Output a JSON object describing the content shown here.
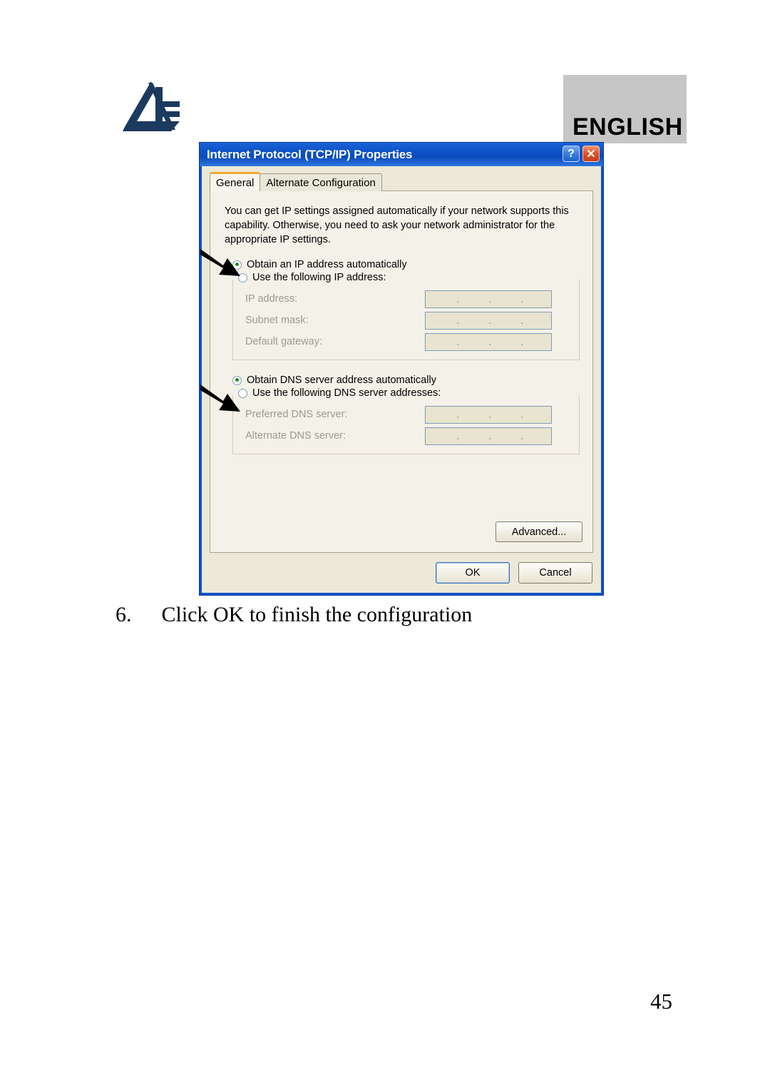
{
  "page": {
    "language_badge": "ENGLISH",
    "page_number": "45",
    "logo_name": "atlantis-land-logo"
  },
  "dialog": {
    "title": "Internet Protocol (TCP/IP) Properties",
    "titlebar_buttons": [
      {
        "name": "help-button",
        "glyph": "?"
      },
      {
        "name": "close-button",
        "glyph": "✕"
      }
    ],
    "tabs": [
      {
        "label": "General",
        "active": true
      },
      {
        "label": "Alternate Configuration",
        "active": false
      }
    ],
    "intro_text": "You can get IP settings assigned automatically if your network supports this capability. Otherwise, you need to ask your network administrator for the appropriate IP settings.",
    "ip_section": {
      "auto_radio_label": "Obtain an IP address automatically",
      "auto_radio_checked": true,
      "manual_radio_label": "Use the following IP address:",
      "manual_radio_checked": false,
      "fields": [
        {
          "label": "IP address:",
          "value": ""
        },
        {
          "label": "Subnet mask:",
          "value": ""
        },
        {
          "label": "Default gateway:",
          "value": ""
        }
      ]
    },
    "dns_section": {
      "auto_radio_label": "Obtain DNS server address automatically",
      "auto_radio_checked": true,
      "manual_radio_label": "Use the following DNS server addresses:",
      "manual_radio_checked": false,
      "fields": [
        {
          "label": "Preferred DNS server:",
          "value": ""
        },
        {
          "label": "Alternate DNS server:",
          "value": ""
        }
      ]
    },
    "advanced_button": "Advanced...",
    "ok_button": "OK",
    "cancel_button": "Cancel"
  },
  "caption": {
    "number": "6.",
    "text": "Click OK to finish the configuration"
  },
  "colors": {
    "titlebar_blue": "#0b50c4",
    "dialog_face": "#ece9d8",
    "tab_highlight_orange": "#f0a830",
    "radio_green": "#1d8c2a",
    "field_disabled": "#e8e4cf",
    "badge_gray": "#c6c6c6",
    "logo_navy": "#1b3a5e"
  }
}
